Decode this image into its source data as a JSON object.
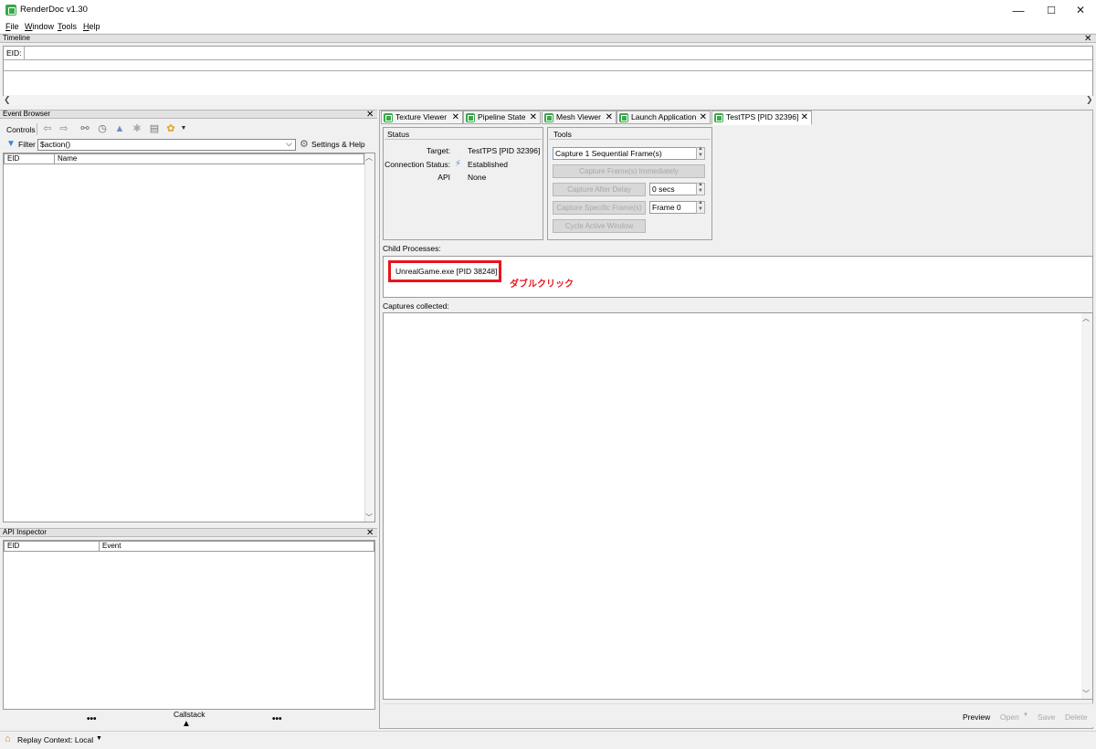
{
  "window": {
    "title": "RenderDoc v1.30",
    "minimize": "—",
    "maximize": "☐",
    "close": "✕"
  },
  "menu": [
    {
      "key": "F",
      "rest": "ile"
    },
    {
      "key": "W",
      "rest": "indow"
    },
    {
      "key": "T",
      "rest": "ools"
    },
    {
      "key": "H",
      "rest": "elp"
    }
  ],
  "timeline": {
    "title": "Timeline",
    "eid_label": "EID:"
  },
  "event_browser": {
    "title": "Event Browser",
    "controls_label": "Controls",
    "filter_label": "Filter",
    "filter_value": "$action()",
    "settings_label": "Settings & Help",
    "columns": [
      "EID",
      "Name"
    ]
  },
  "api_inspector": {
    "title": "API Inspector",
    "columns": [
      "EID",
      "Event"
    ],
    "callstack_label": "Callstack",
    "dots_left": "•••",
    "dots_right": "•••"
  },
  "tabs": [
    {
      "label": "Texture Viewer"
    },
    {
      "label": "Pipeline State"
    },
    {
      "label": "Mesh Viewer"
    },
    {
      "label": "Launch Application"
    },
    {
      "label": "TestTPS [PID 32396]"
    }
  ],
  "status": {
    "title": "Status",
    "target_label": "Target:",
    "target_value": "TestTPS [PID 32396]",
    "connection_label": "Connection Status:",
    "connection_value": "Established",
    "api_label": "API",
    "api_value": "None"
  },
  "tools": {
    "title": "Tools",
    "capture_mode": "Capture 1 Sequential Frame(s)",
    "capture_immediately": "Capture Frame(s) Immediately",
    "capture_after_delay": "Capture After Delay",
    "delay_value": "0 secs",
    "capture_specific": "Capture Specific Frame(s)",
    "frame_value": "Frame 0",
    "cycle_window": "Cycle Active Window"
  },
  "child_processes": {
    "label": "Child Processes:",
    "items": [
      "UnrealGame.exe [PID 38248]"
    ],
    "annotation": "ダブルクリック",
    "highlight_color": "#e8141c"
  },
  "captures": {
    "label": "Captures collected:",
    "preview": "Preview",
    "open": "Open",
    "save": "Save",
    "delete": "Delete"
  },
  "statusbar": {
    "replay_context": "Replay Context: Local"
  },
  "colors": {
    "accent_green": "#3aa84a",
    "annotation_red": "#e8141c"
  }
}
